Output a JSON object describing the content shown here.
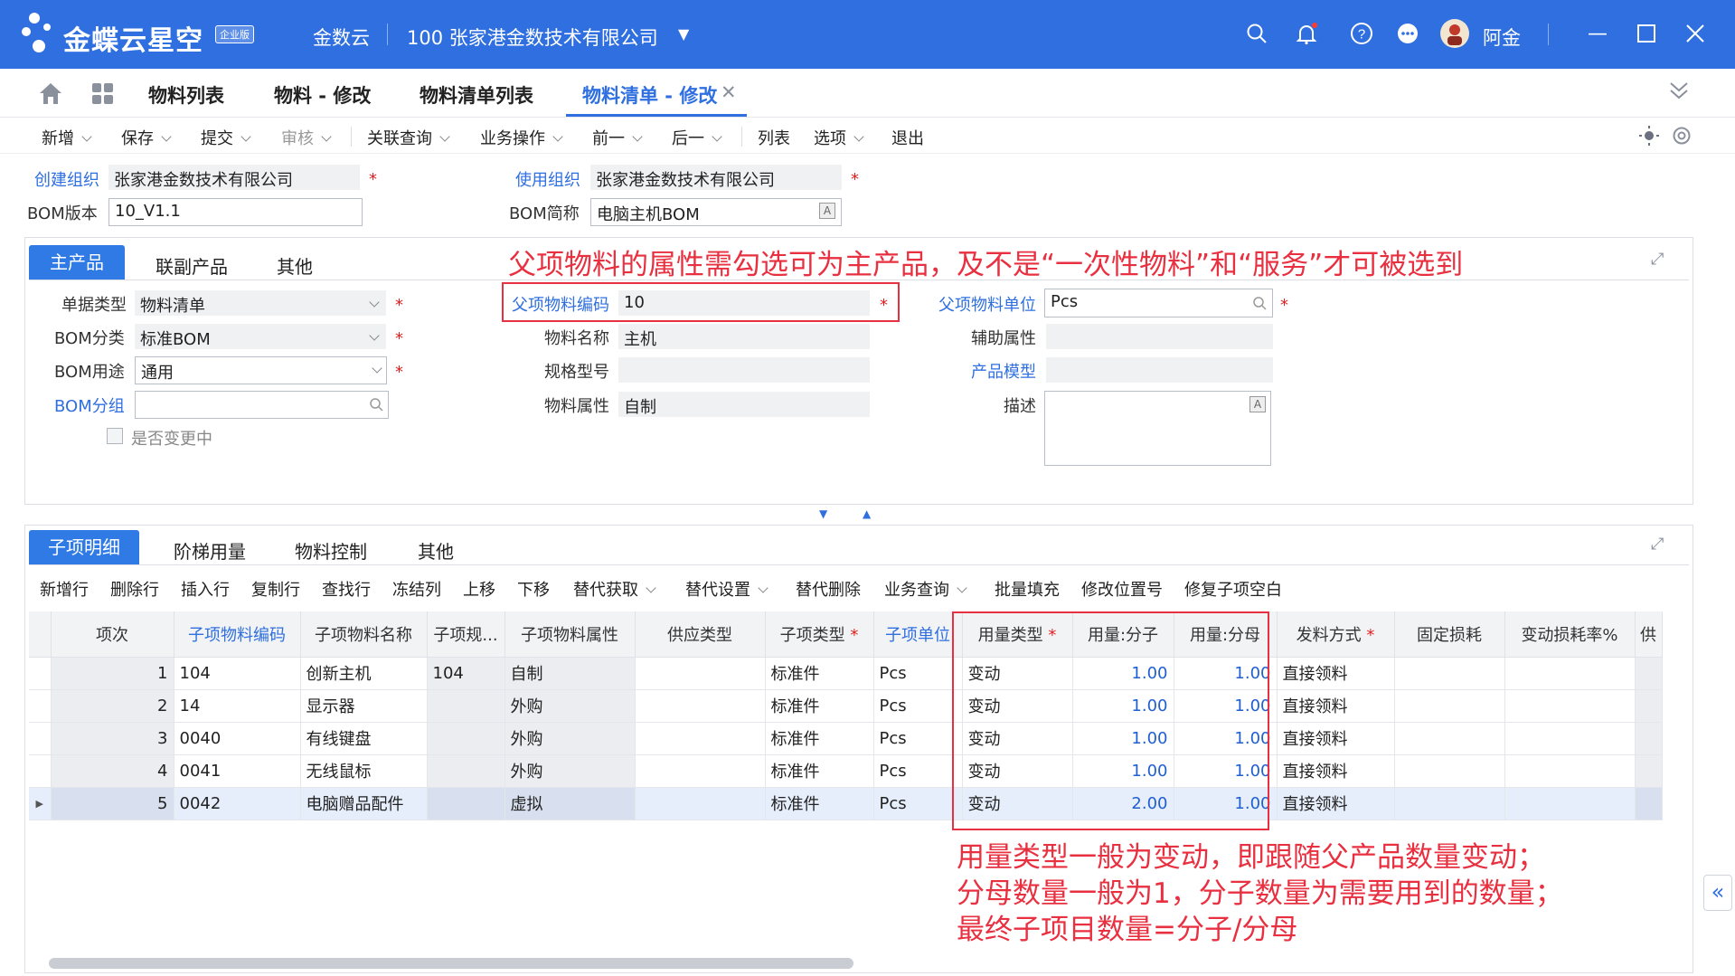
{
  "header": {
    "brand": "金蝶云星空",
    "edition_badge": "企业版",
    "product": "金数云",
    "org": "100  张家港金数技术有限公司",
    "user": "阿金",
    "icons": [
      "search-icon",
      "bell-icon",
      "help-icon",
      "more-icon",
      "avatar",
      "minimize-icon",
      "maximize-icon",
      "close-icon"
    ],
    "accent": "#2f6fe0"
  },
  "tabs": [
    {
      "label": "物料列表"
    },
    {
      "label": "物料 - 修改"
    },
    {
      "label": "物料清单列表"
    },
    {
      "label": "物料清单 - 修改",
      "active": true
    }
  ],
  "toolbar": [
    "新增",
    "保存",
    "提交",
    "审核",
    "关联查询",
    "业务操作",
    "前一",
    "后一",
    "列表",
    "选项",
    "退出"
  ],
  "head": {
    "create_org_label": "创建组织",
    "create_org": "张家港金数技术有限公司",
    "use_org_label": "使用组织",
    "use_org": "张家港金数技术有限公司",
    "bom_version_label": "BOM版本",
    "bom_version": "10_V1.1",
    "bom_short_label": "BOM简称",
    "bom_short": "电脑主机BOM"
  },
  "main_panel": {
    "tabs": [
      "主产品",
      "联副产品",
      "其他"
    ],
    "doc_type_label": "单据类型",
    "doc_type": "物料清单",
    "bom_category_label": "BOM分类",
    "bom_category": "标准BOM",
    "bom_usage_label": "BOM用途",
    "bom_usage": "通用",
    "bom_group_label": "BOM分组",
    "bom_group": "",
    "changing_label": "是否变更中",
    "parent_code_label": "父项物料编码",
    "parent_code": "10",
    "material_name_label": "物料名称",
    "material_name": "主机",
    "spec_label": "规格型号",
    "spec": "",
    "material_attr_label": "物料属性",
    "material_attr": "自制",
    "parent_unit_label": "父项物料单位",
    "parent_unit": "Pcs",
    "aux_attr_label": "辅助属性",
    "aux_attr": "",
    "product_model_label": "产品模型",
    "product_model": "",
    "desc_label": "描述",
    "desc": ""
  },
  "annotation_top": "父项物料的属性需勾选可为主产品，及不是“一次性物料”和“服务”才可被选到",
  "detail_panel": {
    "tabs": [
      "子项明细",
      "阶梯用量",
      "物料控制",
      "其他"
    ],
    "toolbar": [
      "新增行",
      "删除行",
      "插入行",
      "复制行",
      "查找行",
      "冻结列",
      "上移",
      "下移",
      "替代获取",
      "替代设置",
      "替代删除",
      "业务查询",
      "批量填充",
      "修改位置号",
      "修复子项空白"
    ],
    "columns": [
      "项次",
      "子项物料编码",
      "子项物料名称",
      "子项规...",
      "子项物料属性",
      "供应类型",
      "子项类型",
      "子项单位",
      "用量类型",
      "用量:分子",
      "用量:分母",
      "发料方式",
      "固定损耗",
      "变动损耗率%",
      "供"
    ],
    "rows": [
      {
        "idx": "1",
        "code": "104",
        "name": "创新主机",
        "spec": "104",
        "attr": "自制",
        "supply": "",
        "type": "标准件",
        "unit": "Pcs",
        "qty_type": "变动",
        "num": "1.00",
        "den": "1.00",
        "issue": "直接领料"
      },
      {
        "idx": "2",
        "code": "14",
        "name": "显示器",
        "spec": "",
        "attr": "外购",
        "supply": "",
        "type": "标准件",
        "unit": "Pcs",
        "qty_type": "变动",
        "num": "1.00",
        "den": "1.00",
        "issue": "直接领料"
      },
      {
        "idx": "3",
        "code": "0040",
        "name": "有线键盘",
        "spec": "",
        "attr": "外购",
        "supply": "",
        "type": "标准件",
        "unit": "Pcs",
        "qty_type": "变动",
        "num": "1.00",
        "den": "1.00",
        "issue": "直接领料"
      },
      {
        "idx": "4",
        "code": "0041",
        "name": "无线鼠标",
        "spec": "",
        "attr": "外购",
        "supply": "",
        "type": "标准件",
        "unit": "Pcs",
        "qty_type": "变动",
        "num": "1.00",
        "den": "1.00",
        "issue": "直接领料"
      },
      {
        "idx": "5",
        "code": "0042",
        "name": "电脑赠品配件",
        "spec": "",
        "attr": "虚拟",
        "supply": "",
        "type": "标准件",
        "unit": "Pcs",
        "qty_type": "变动",
        "num": "2.00",
        "den": "1.00",
        "issue": "直接领料"
      }
    ]
  },
  "annotation_bottom": [
    "用量类型一般为变动，即跟随父产品数量变动；",
    "分母数量一般为1，分子数量为需要用到的数量；",
    "最终子项目数量=分子/分母"
  ]
}
